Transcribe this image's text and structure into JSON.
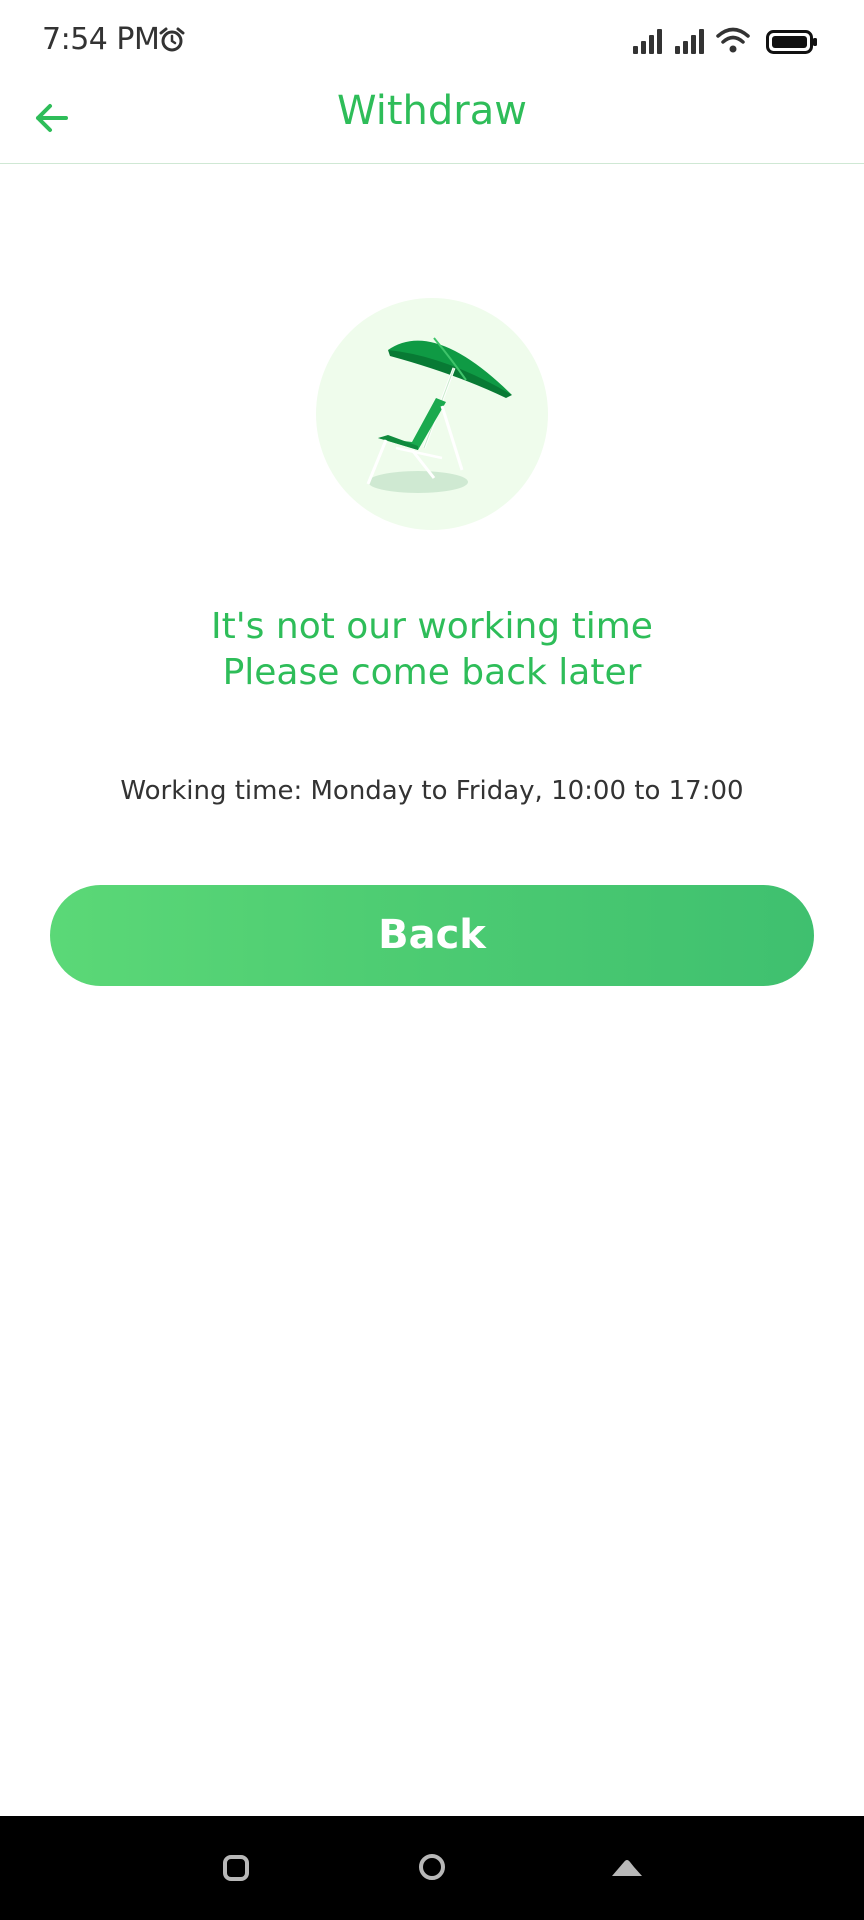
{
  "status_bar": {
    "time": "7:54 PM",
    "icons": [
      "alarm-icon",
      "signal-icon",
      "signal-icon",
      "wifi-icon",
      "battery-icon"
    ]
  },
  "header": {
    "title": "Withdraw",
    "back_icon": "arrow-left-icon"
  },
  "illustration": {
    "icon": "beach-umbrella-chair-icon"
  },
  "message": {
    "line1": "It's not our working time",
    "line2": "Please come back later"
  },
  "working_time": "Working time: Monday to Friday, 10:00 to 17:00",
  "back_button_label": "Back",
  "nav_bar": {
    "icons": [
      "recent-apps-icon",
      "home-icon",
      "back-icon"
    ]
  },
  "colors": {
    "accent": "#2ebd59",
    "button_start": "#5bd877",
    "button_end": "#3fc06f",
    "illustration_bg": "#effcec",
    "text_dark": "#333333"
  }
}
